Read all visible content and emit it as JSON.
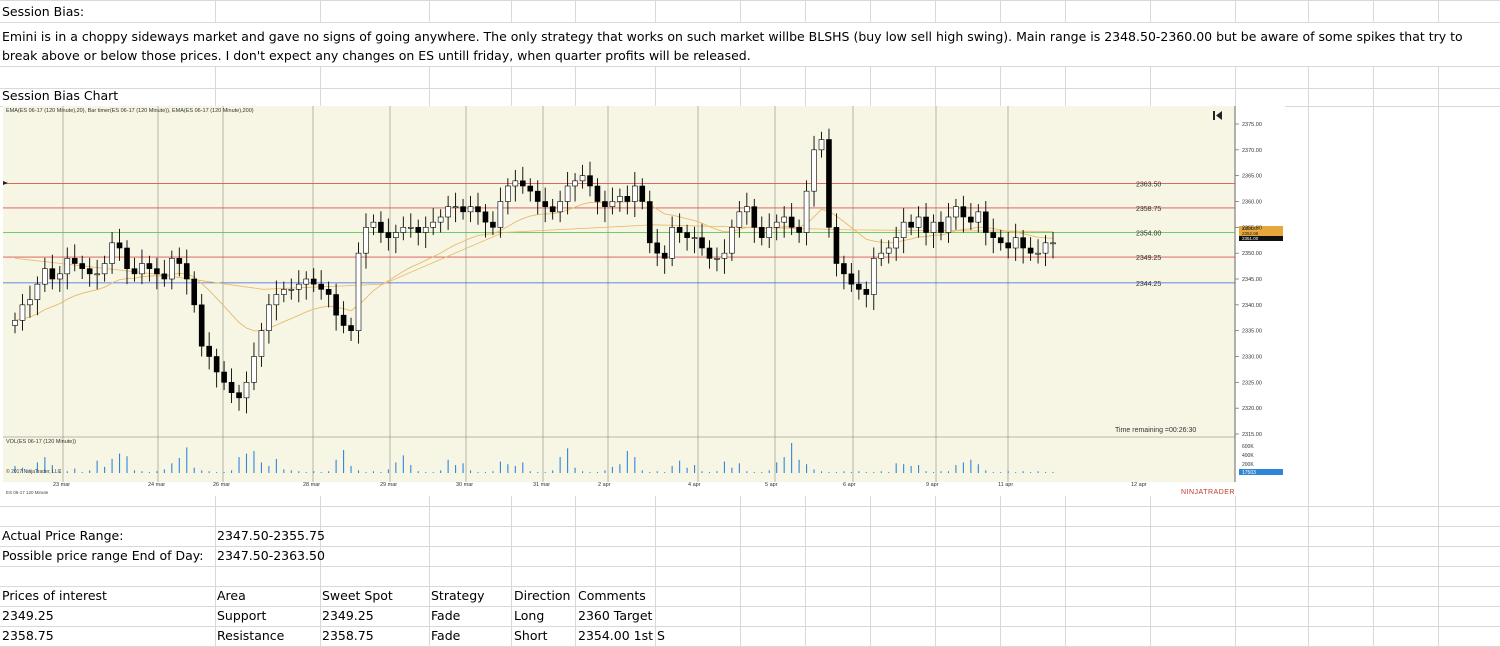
{
  "sheet": {
    "session_bias_label": "Session Bias:",
    "session_bias_text": "Emini is in a choppy sideways market and gave no signs of going anywhere. The only strategy that works on such market willbe BLSHS (buy low sell high swing). Main range is 2348.50-2360.00 but be aware of some spikes that try to break above or below those prices. I don't expect any changes on ES untill friday, when quarter profits will be released.",
    "chart_title": "Session Bias Chart",
    "actual_range_label": "Actual Price Range:",
    "actual_range_value": "2347.50-2355.75",
    "possible_range_label": "Possible price range End of Day:",
    "possible_range_value": "2347.50-2363.50",
    "table_headers": [
      "Prices of interest",
      "Area",
      "Sweet Spot",
      "Strategy",
      "Direction",
      "Comments"
    ],
    "table_rows": [
      [
        "2349.25",
        "Support",
        "2349.25",
        "Fade",
        "Long",
        "2360 Target"
      ],
      [
        "2358.75",
        "Resistance",
        "2358.75",
        "Fade",
        "Short",
        "2354.00 1st S"
      ]
    ]
  },
  "chart_data": {
    "type": "candlestick",
    "indicator_label": "EMA(ES 06-17 (120 Minute),20), Bar timer(ES 06-17 (120 Minute)), EMA(ES 06-17 (120 Minute),200)",
    "volume_label": "VOL(ES 06-17 (120 Minute))",
    "copyright": "© 2017 NinjaTrader, LLC",
    "instrument": "ES 06-17 120 Minute",
    "timer_text": "Time remaining =00:26:30",
    "brand": "NINJATRADER",
    "colors": {
      "background": "#f7f6e4",
      "up": "#ffffff",
      "down": "#000000",
      "ema20": "#e8b96a",
      "ema200": "#e8b96a",
      "volume": "#2f86d8",
      "red_line": "#d9534f",
      "green_line": "#40c040",
      "blue_line": "#3b5fe0"
    },
    "ylim": [
      2315,
      2375
    ],
    "y_ticks": [
      "2375.00",
      "2370.00",
      "2365.00",
      "2360.00",
      "2355.00",
      "2350.00",
      "2345.00",
      "2340.00",
      "2335.00",
      "2330.00",
      "2325.00",
      "2320.00",
      "2315.00"
    ],
    "x_ticks": [
      "23 mar",
      "24 mar",
      "26 mar",
      "28 mar",
      "29 mar",
      "30 mar",
      "31 mar",
      "2 apr",
      "4 apr",
      "5 apr",
      "6 apr",
      "9 apr",
      "11 apr",
      "12 apr"
    ],
    "levels": [
      {
        "label": "2363.50",
        "value": 2363.5,
        "color": "red"
      },
      {
        "label": "2358.75",
        "value": 2358.75,
        "color": "red"
      },
      {
        "label": "2354.00",
        "value": 2354.0,
        "color": "green"
      },
      {
        "label": "2349.25",
        "value": 2349.25,
        "color": "red"
      },
      {
        "label": "2344.25",
        "value": 2344.25,
        "color": "blue"
      }
    ],
    "price_markers": [
      "2354.47",
      "2352.95",
      "2351.00"
    ],
    "volume_ticks": [
      "600K",
      "400K",
      "200K"
    ],
    "current_volume": "17503",
    "closes": [
      2337,
      2340,
      2341,
      2344,
      2347,
      2345,
      2346,
      2349,
      2348,
      2347,
      2346,
      2346,
      2348,
      2352,
      2351,
      2347,
      2346,
      2348,
      2347,
      2346,
      2345,
      2349,
      2348,
      2345,
      2340,
      2332,
      2330,
      2327,
      2325,
      2323,
      2322,
      2325,
      2330,
      2335,
      2340,
      2342,
      2343,
      2343,
      2344,
      2345,
      2344,
      2343,
      2342,
      2338,
      2336,
      2335,
      2350,
      2355,
      2356,
      2354,
      2353,
      2354,
      2355,
      2355,
      2354,
      2355,
      2356,
      2357,
      2359,
      2359,
      2358,
      2359,
      2358,
      2356,
      2355,
      2360,
      2363,
      2364,
      2363,
      2362,
      2360,
      2359,
      2358,
      2360,
      2363,
      2364,
      2365,
      2363,
      2360,
      2359,
      2360,
      2361,
      2360,
      2363,
      2360,
      2352,
      2350,
      2349,
      2355,
      2354,
      2353,
      2353,
      2351,
      2349,
      2349,
      2350,
      2355,
      2358,
      2359,
      2355,
      2353,
      2355,
      2356,
      2357,
      2355,
      2354,
      2362,
      2370,
      2372,
      2355,
      2348,
      2346,
      2344,
      2343,
      2342,
      2349,
      2350,
      2351,
      2353,
      2356,
      2355,
      2357,
      2354,
      2356,
      2354,
      2357,
      2359,
      2357,
      2356,
      2358,
      2354,
      2353,
      2352,
      2351,
      2353,
      2351,
      2350,
      2350,
      2352,
      2352
    ],
    "volumes": [
      8,
      6,
      4,
      12,
      18,
      9,
      3,
      2,
      5,
      1,
      3,
      14,
      7,
      16,
      22,
      19,
      3,
      2,
      1,
      2,
      4,
      11,
      17,
      29,
      6,
      3,
      2,
      1,
      1,
      3,
      18,
      22,
      25,
      12,
      8,
      16,
      4,
      3,
      2,
      1,
      2,
      1,
      2,
      15,
      26,
      8,
      3,
      1,
      2,
      1,
      4,
      12,
      20,
      9,
      2,
      1,
      1,
      3,
      15,
      9,
      11,
      3,
      1,
      1,
      2,
      13,
      10,
      8,
      12,
      2,
      1,
      1,
      3,
      18,
      28,
      6,
      2,
      1,
      1,
      3,
      7,
      10,
      25,
      18,
      3,
      1,
      2,
      1,
      8,
      14,
      6,
      9,
      2,
      1,
      2,
      13,
      6,
      11,
      2,
      1,
      1,
      3,
      12,
      18,
      34,
      15,
      10,
      4,
      2,
      1,
      1,
      2,
      1,
      2,
      1,
      1,
      2,
      1,
      11,
      10,
      8,
      9,
      2,
      1,
      2,
      2,
      9,
      12,
      15,
      10,
      3,
      1,
      1,
      2,
      1,
      2,
      1,
      2,
      1,
      1
    ]
  }
}
